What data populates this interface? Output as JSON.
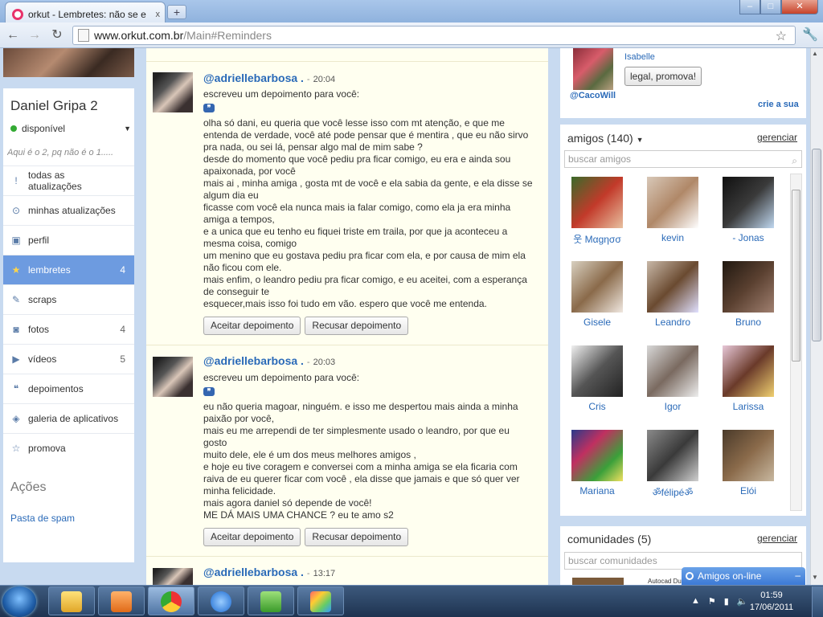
{
  "browser": {
    "tab_title": "orkut - Lembretes: não se e",
    "tab_close": "x",
    "new_tab": "+",
    "url_host": "www.orkut.com.br",
    "url_path": "/Main#Reminders",
    "win_min": "–",
    "win_max": "□",
    "win_close": "✕",
    "icons": [
      "back-arrow-icon",
      "forward-arrow-icon",
      "reload-icon",
      "star-icon",
      "wrench-icon"
    ]
  },
  "sidebar": {
    "user_name": "Daniel Gripa 2",
    "status": "disponível",
    "quote": "Aqui é o 2, pq não é o 1.....",
    "items": [
      {
        "label": "todas as atualizações",
        "count": "",
        "icon": "info-icon",
        "glyph": "!"
      },
      {
        "label": "minhas atualizações",
        "count": "",
        "icon": "broadcast-icon",
        "glyph": "⊙"
      },
      {
        "label": "perfil",
        "count": "",
        "icon": "profile-card-icon",
        "glyph": "▣"
      },
      {
        "label": "lembretes",
        "count": "4",
        "icon": "reminder-icon",
        "glyph": "★"
      },
      {
        "label": "scraps",
        "count": "",
        "icon": "scrap-icon",
        "glyph": "✎"
      },
      {
        "label": "fotos",
        "count": "4",
        "icon": "camera-icon",
        "glyph": "◙"
      },
      {
        "label": "vídeos",
        "count": "5",
        "icon": "video-icon",
        "glyph": "▶"
      },
      {
        "label": "depoimentos",
        "count": "",
        "icon": "quote-icon",
        "glyph": "❝"
      },
      {
        "label": "galeria de aplicativos",
        "count": "",
        "icon": "gamepad-icon",
        "glyph": "◈"
      },
      {
        "label": "promova",
        "count": "",
        "icon": "promote-icon",
        "glyph": "☆"
      }
    ],
    "actions_title": "Ações",
    "spam_link": "Pasta de spam"
  },
  "posts": [
    {
      "author": "@adriellebarbosa .",
      "sep": "-",
      "time": "20:04",
      "intro": "escreveu um depoimento para você:",
      "body": "olha só dani, eu queria que você lesse isso com mt atenção, e que me\nentenda de verdade, você até pode pensar que é mentira , que eu não sirvo\npra nada, ou sei lá, pensar algo mal de mim sabe ?\ndesde do momento que você pediu pra ficar comigo, eu era e ainda sou\napaixonada, por você\nmais ai , minha amiga , gosta mt de você e ela sabia da gente, e ela disse se\nalgum dia eu\nficasse com você ela nunca mais ia falar comigo, como ela ja era minha\namiga a tempos,\ne a unica que eu tenho eu fiquei triste em traila, por que ja aconteceu a\nmesma coisa, comigo\num menino que eu gostava pediu pra ficar com ela, e por causa de mim ela\nnão ficou com ele.\nmais enfim, o leandro pediu pra ficar comigo, e eu aceitei, com a esperança\nde conseguir te\nesquecer,mais isso foi tudo em vão. espero que você me entenda.",
      "accept": "Aceitar depoimento",
      "reject": "Recusar depoimento"
    },
    {
      "author": "@adriellebarbosa .",
      "sep": "-",
      "time": "20:03",
      "intro": "escreveu um depoimento para você:",
      "body": "eu não queria magoar, ninguém. e isso me despertou mais ainda a minha\npaixão por você,\nmais eu me arrependi de ter simplesmente usado o leandro, por que eu\ngosto\nmuito dele, ele é um dos meus melhores amigos ,\ne hoje eu tive coragem e conversei com a minha amiga se ela ficaria com\nraiva de eu querer ficar com você , ela disse que jamais e que só quer ver\nminha felicidade.\nmais agora daniel só depende de você!\nME DÁ MAIS UMA CHANCE ? eu te amo s2",
      "accept": "Aceitar depoimento",
      "reject": "Recusar depoimento"
    },
    {
      "author": "@adriellebarbosa .",
      "sep": "-",
      "time": "13:17"
    }
  ],
  "promo": {
    "by": "@CacoWill",
    "name": "Isabelle",
    "button": "legal, promova!",
    "create": "crie a sua"
  },
  "friends": {
    "title": "amigos (140)",
    "manage": "gerenciar",
    "search_placeholder": "buscar amigos",
    "list": [
      {
        "name": "웃 Mαgησσ"
      },
      {
        "name": "kevin"
      },
      {
        "name": "- Jonas"
      },
      {
        "name": "Gisele"
      },
      {
        "name": "Leandro"
      },
      {
        "name": "Bruno"
      },
      {
        "name": "Cris"
      },
      {
        "name": "Igor"
      },
      {
        "name": "Larissa"
      },
      {
        "name": "Mariana"
      },
      {
        "name": "ॐfélipéॐ"
      },
      {
        "name": "Elói"
      }
    ]
  },
  "communities": {
    "title": "comunidades (5)",
    "manage": "gerenciar",
    "search_placeholder": "buscar comunidades",
    "thumb_caption": "Autocad Du"
  },
  "chat": {
    "label": "Amigos on-line",
    "minimize": "–"
  },
  "taskbar": {
    "time": "01:59",
    "date": "17/06/2011"
  }
}
